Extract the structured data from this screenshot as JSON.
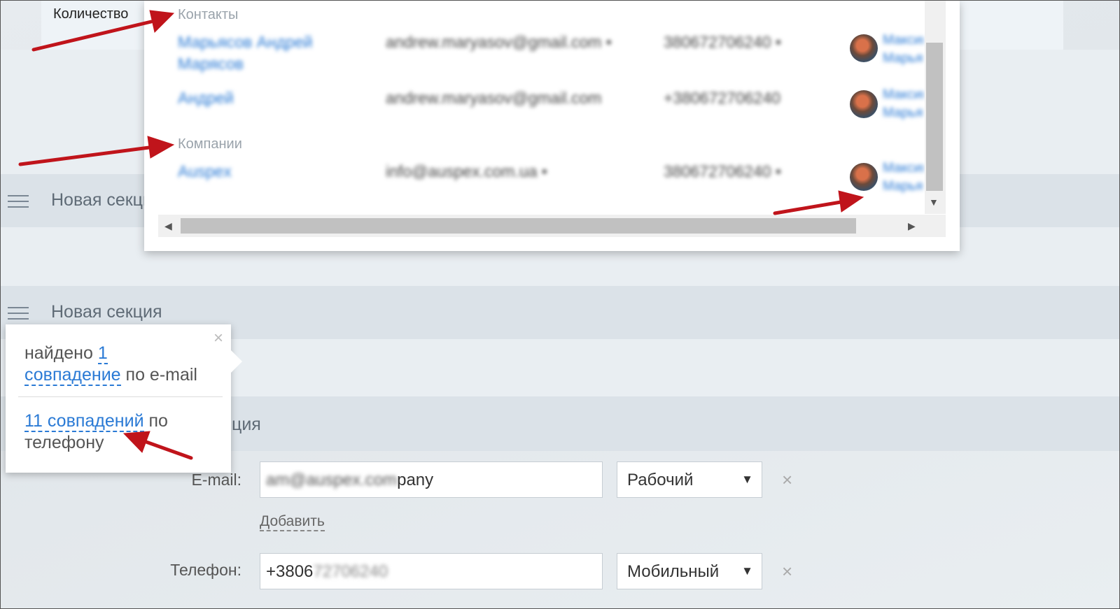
{
  "top": {
    "quantity_label": "Количество"
  },
  "sections": [
    {
      "title": "Новая секция"
    },
    {
      "title": "Новая секция"
    },
    {
      "title": "ция"
    }
  ],
  "dropdown": {
    "contacts_label": "Контакты",
    "companies_label": "Компании",
    "contacts": [
      {
        "name_line1": "Марьясов Андрей",
        "name_line2": "Марясов",
        "email": "andrew.maryasov@gmail.com •",
        "phone": "380672706240 •",
        "responsible": "Максим Марьясов"
      },
      {
        "name_line1": "Андрей",
        "name_line2": "",
        "email": "andrew.maryasov@gmail.com",
        "phone": "+380672706240",
        "responsible": "Максим Марьясов"
      }
    ],
    "companies": [
      {
        "name": "Auspex",
        "email": "info@auspex.com.ua •",
        "phone": "380672706240 •",
        "responsible": "Максим Марьясов"
      }
    ]
  },
  "popup": {
    "email_prefix": "найдено",
    "email_count_link_a": "1",
    "email_count_link_b": "совпадение",
    "email_suffix": "по e-mail",
    "phone_link": "11 совпадений",
    "phone_suffix_a": "по",
    "phone_suffix_b": "телефону",
    "close": "×"
  },
  "form": {
    "email_label": "E-mail:",
    "email_value_blurred": "am@auspex.com",
    "email_value_visible": "pany",
    "email_type": "Рабочий",
    "add_label": "Добавить",
    "phone_label": "Телефон:",
    "phone_value_visible": "+3806",
    "phone_value_blurred": "72706240",
    "phone_type": "Мобильный",
    "remove": "×",
    "select_arrow": "▼"
  },
  "colors": {
    "link": "#2a7ad5",
    "annotation_arrow": "#c0141b"
  }
}
